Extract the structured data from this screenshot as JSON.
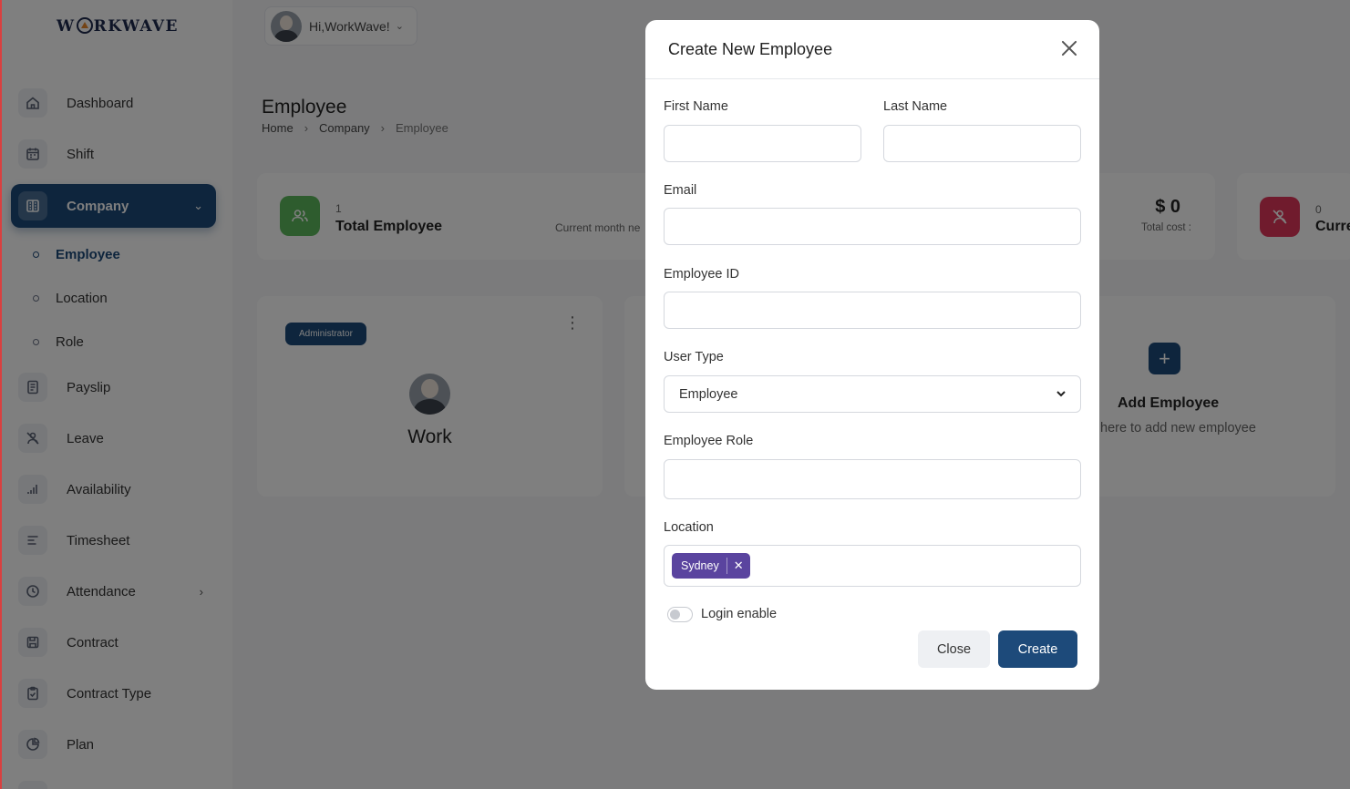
{
  "app": {
    "logo_text_left": "W",
    "logo_text_right": "RKWAVE"
  },
  "sidebar": {
    "items": [
      {
        "label": "Dashboard",
        "icon": "home-icon"
      },
      {
        "label": "Shift",
        "icon": "calendar-icon"
      },
      {
        "label": "Company",
        "icon": "building-icon",
        "expanded": true
      },
      {
        "label": "Payslip",
        "icon": "document-icon"
      },
      {
        "label": "Leave",
        "icon": "person-off-icon"
      },
      {
        "label": "Availability",
        "icon": "bars-icon"
      },
      {
        "label": "Timesheet",
        "icon": "lines-icon"
      },
      {
        "label": "Attendance",
        "icon": "clock-icon"
      },
      {
        "label": "Contract",
        "icon": "save-icon"
      },
      {
        "label": "Contract Type",
        "icon": "clipboard-icon"
      },
      {
        "label": "Plan",
        "icon": "pie-icon"
      }
    ],
    "sub_items": [
      {
        "label": "Employee",
        "active": true
      },
      {
        "label": "Location"
      },
      {
        "label": "Role"
      }
    ]
  },
  "topbar": {
    "greeting": "Hi,WorkWave!"
  },
  "page": {
    "title": "Employee",
    "breadcrumb": [
      "Home",
      "Company",
      "Employee"
    ],
    "stats": {
      "total_employee_count": "1",
      "total_employee_label": "Total Employee",
      "current_month_text": "Current month ne",
      "total_cost_value": "$ 0",
      "total_cost_label": "Total cost :",
      "current_count": "0",
      "current_label": "Curre"
    },
    "employee_card": {
      "badge": "Administrator",
      "name": "Work"
    },
    "add_card": {
      "title": "Add Employee",
      "subtitle": "here to add new employee"
    }
  },
  "modal": {
    "title": "Create New Employee",
    "fields": {
      "first_name_label": "First Name",
      "first_name_value": "",
      "last_name_label": "Last Name",
      "last_name_value": "",
      "email_label": "Email",
      "email_value": "",
      "employee_id_label": "Employee ID",
      "employee_id_value": "",
      "user_type_label": "User Type",
      "user_type_value": "Employee",
      "employee_role_label": "Employee Role",
      "employee_role_value": "",
      "location_label": "Location",
      "location_tags": [
        "Sydney"
      ],
      "login_enable_label": "Login enable",
      "login_enable": false
    },
    "buttons": {
      "close": "Close",
      "create": "Create"
    }
  },
  "colors": {
    "primary": "#1d4a7a",
    "tag": "#5a449f",
    "stat_green": "#5cb85c",
    "stat_red": "#e0365a"
  }
}
